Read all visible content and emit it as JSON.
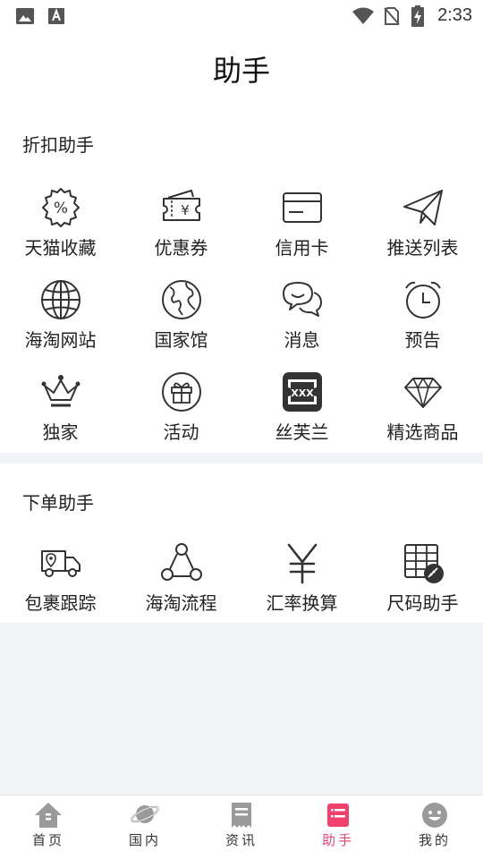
{
  "status_bar": {
    "time": "2:33"
  },
  "header": {
    "title": "助手"
  },
  "discount_section": {
    "title": "折扣助手",
    "items": [
      {
        "label": "天猫收藏",
        "icon": "percent-badge-icon"
      },
      {
        "label": "优惠券",
        "icon": "coupon-icon"
      },
      {
        "label": "信用卡",
        "icon": "credit-card-icon"
      },
      {
        "label": "推送列表",
        "icon": "paper-plane-icon"
      },
      {
        "label": "海淘网站",
        "icon": "globe-icon"
      },
      {
        "label": "国家馆",
        "icon": "earth-icon"
      },
      {
        "label": "消息",
        "icon": "chat-bubbles-icon"
      },
      {
        "label": "预告",
        "icon": "alarm-clock-icon"
      },
      {
        "label": "独家",
        "icon": "crown-icon"
      },
      {
        "label": "活动",
        "icon": "gift-icon"
      },
      {
        "label": "丝芙兰",
        "icon": "sephora-icon",
        "icon_text": "XXX"
      },
      {
        "label": "精选商品",
        "icon": "diamond-icon"
      }
    ]
  },
  "order_section": {
    "title": "下单助手",
    "items": [
      {
        "label": "包裹跟踪",
        "icon": "delivery-truck-icon"
      },
      {
        "label": "海淘流程",
        "icon": "process-flow-icon"
      },
      {
        "label": "汇率换算",
        "icon": "yen-icon"
      },
      {
        "label": "尺码助手",
        "icon": "size-chart-icon"
      }
    ]
  },
  "tabbar": {
    "tabs": [
      {
        "label": "首页",
        "icon": "home-icon",
        "active": false
      },
      {
        "label": "国内",
        "icon": "planet-icon",
        "active": false
      },
      {
        "label": "资讯",
        "icon": "receipt-icon",
        "active": false
      },
      {
        "label": "助手",
        "icon": "helper-list-icon",
        "active": true
      },
      {
        "label": "我的",
        "icon": "smiley-face-icon",
        "active": false
      }
    ]
  },
  "colors": {
    "accent": "#f0416c",
    "icon_stroke": "#333333",
    "tab_icon": "#9a9a9a"
  }
}
